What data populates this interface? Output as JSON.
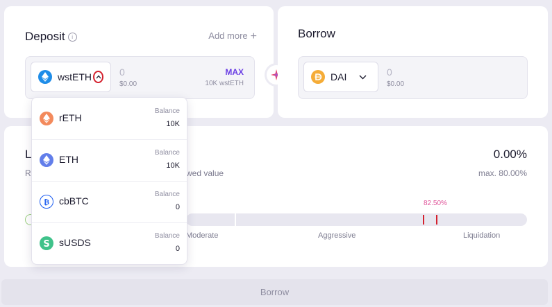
{
  "deposit": {
    "title": "Deposit",
    "info_icon": "i",
    "add_more": "Add more",
    "add_more_plus": "+",
    "token": "wstETH",
    "amount": "0",
    "amount_usd": "$0.00",
    "max_label": "MAX",
    "max_balance": "10K wstETH"
  },
  "borrow": {
    "title": "Borrow",
    "token": "DAI",
    "amount": "0",
    "amount_usd": "$0.00"
  },
  "ltv": {
    "title_partial": "L",
    "sub_partial_left": "R",
    "sub_partial": "wed value",
    "value": "0.00%",
    "max": "max. 80.00%",
    "liquidation_pct": "82.50%",
    "zones": [
      "Moderate",
      "Aggressive",
      "Liquidation"
    ]
  },
  "dropdown": {
    "items": [
      {
        "name": "rETH",
        "balance_label": "Balance",
        "balance": "10K",
        "icon": "reth-icon",
        "color": "#f38a5c"
      },
      {
        "name": "ETH",
        "balance_label": "Balance",
        "balance": "10K",
        "icon": "eth-icon",
        "color": "#627eea"
      },
      {
        "name": "cbBTC",
        "balance_label": "Balance",
        "balance": "0",
        "icon": "cbbtc-icon",
        "color": "#1a5bf0"
      },
      {
        "name": "sUSDS",
        "balance_label": "Balance",
        "balance": "0",
        "icon": "susds-icon",
        "color": "#3fc28a"
      }
    ]
  },
  "footer": {
    "borrow_button": "Borrow"
  },
  "colors": {
    "accent": "#6b3fe4",
    "danger": "#d4212e",
    "background": "#ecebf3",
    "card": "#ffffff"
  }
}
